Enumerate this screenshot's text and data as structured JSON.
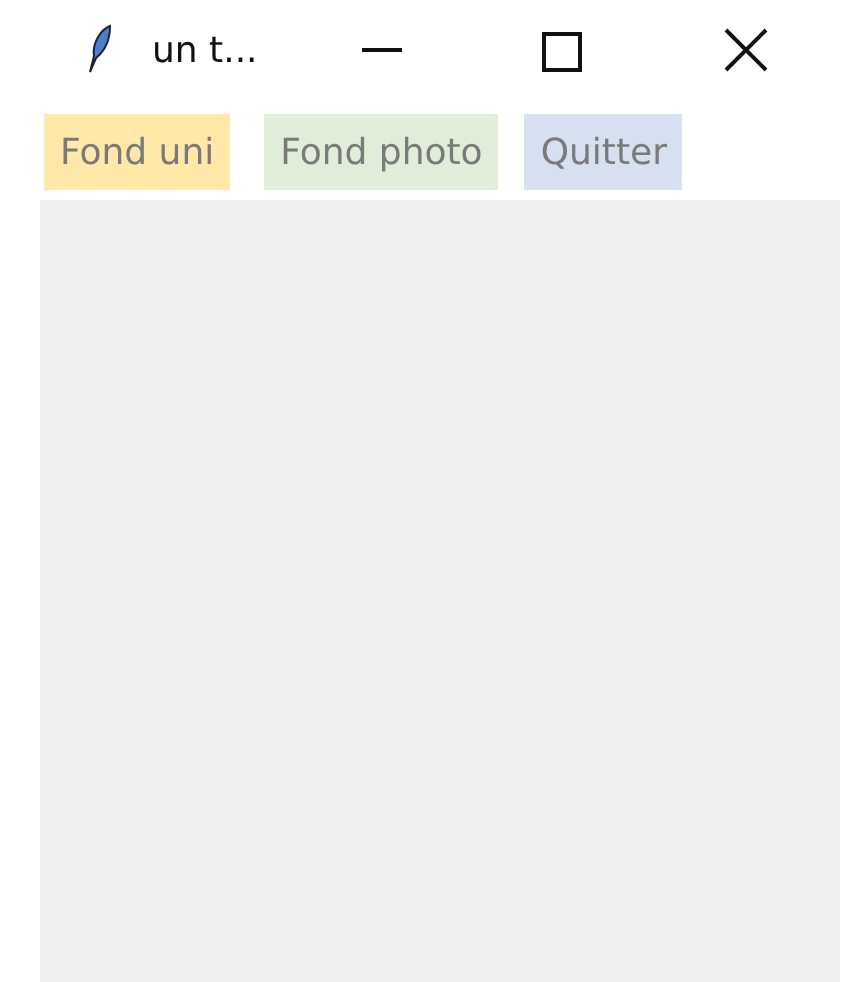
{
  "window": {
    "title": "un t..."
  },
  "buttons": [
    {
      "label": "Fond uni",
      "color": "#ffe8a8"
    },
    {
      "label": "Fond photo",
      "color": "#e0edd8"
    },
    {
      "label": "Quitter",
      "color": "#d6e0f0"
    }
  ]
}
